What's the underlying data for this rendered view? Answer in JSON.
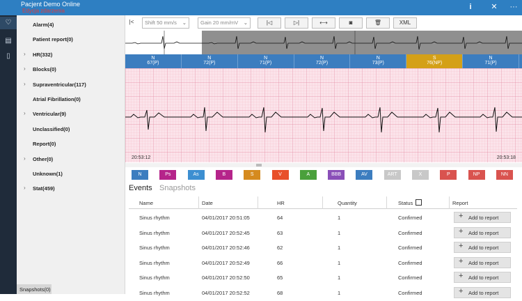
{
  "app": {
    "title": "Pacjent Demo Online",
    "subtitle": "Edycja zdarzenia"
  },
  "titlebar": {
    "info_icon": "info-icon",
    "close_icon": "close-icon",
    "more_icon": "more-icon",
    "info_glyph": "i",
    "close_glyph": "✕",
    "more_glyph": "···"
  },
  "rail": [
    {
      "name": "heart-monitor-icon",
      "glyph": "♡"
    },
    {
      "name": "clipboard-icon",
      "glyph": "▤"
    },
    {
      "name": "document-icon",
      "glyph": "▯"
    }
  ],
  "sidebar": {
    "items": [
      {
        "label": "Alarm(4)",
        "expandable": false
      },
      {
        "label": "Patient report(0)",
        "expandable": false
      },
      {
        "label": "HR(332)",
        "expandable": true
      },
      {
        "label": "Blocks(0)",
        "expandable": true
      },
      {
        "label": "Supraventricular(117)",
        "expandable": true
      },
      {
        "label": "Atrial Fibrillation(0)",
        "expandable": false
      },
      {
        "label": "Ventricular(9)",
        "expandable": true
      },
      {
        "label": "Unclassified(0)",
        "expandable": false
      },
      {
        "label": "Report(0)",
        "expandable": false
      },
      {
        "label": "Other(0)",
        "expandable": true
      },
      {
        "label": "Unknown(1)",
        "expandable": false
      },
      {
        "label": "Stat(459)",
        "expandable": true
      }
    ],
    "snapshots_tab": "Snapshots(0)"
  },
  "toolbar": {
    "collapse_glyph": "|<",
    "shift_value": "Shift 50  mm/s",
    "gain_value": "Gain 20  mm/mV",
    "prev_glyph": "|◁",
    "next_glyph": "▷|",
    "fit_glyph": "⟷",
    "camera_glyph": "◙",
    "delete_glyph": "🗑",
    "xml_label": "XML"
  },
  "beats": [
    {
      "type": "N",
      "value": "67(P)",
      "color": "#3c7dbf"
    },
    {
      "type": "N",
      "value": "72(P)",
      "color": "#3c7dbf"
    },
    {
      "type": "N",
      "value": "71(P)",
      "color": "#3c7dbf"
    },
    {
      "type": "N",
      "value": "72(P)",
      "color": "#3c7dbf"
    },
    {
      "type": "N",
      "value": "73(P)",
      "color": "#3c7dbf"
    },
    {
      "type": "S",
      "value": "76(NP)",
      "color": "#d4a017"
    },
    {
      "type": "N",
      "value": "71(P)",
      "color": "#3c7dbf"
    }
  ],
  "ecg": {
    "time_start": "20:53:12",
    "time_end": "20:53:18"
  },
  "beat_types": [
    {
      "label": "N",
      "color": "#3c7dbf"
    },
    {
      "label": "Ps",
      "color": "#b5248a"
    },
    {
      "label": "As",
      "color": "#3c8fd1"
    },
    {
      "label": "B",
      "color": "#b5248a"
    },
    {
      "label": "S",
      "color": "#d58a1e"
    },
    {
      "label": "V",
      "color": "#e8502a"
    },
    {
      "label": "A",
      "color": "#4aa03c"
    },
    {
      "label": "BBB",
      "color": "#8a4fb8"
    },
    {
      "label": "AV",
      "color": "#3c7dbf"
    },
    {
      "label": "ART",
      "color": "#c8c8c8"
    },
    {
      "label": "X",
      "color": "#c8c8c8"
    },
    {
      "label": "P",
      "color": "#d9534f"
    },
    {
      "label": "NP",
      "color": "#d9534f"
    },
    {
      "label": "NN",
      "color": "#d9534f"
    }
  ],
  "tabs": [
    {
      "label": "Events",
      "active": true
    },
    {
      "label": "Snapshots",
      "active": false
    }
  ],
  "table": {
    "headers": [
      "Name",
      "Date",
      "HR",
      "Quantity",
      "Status",
      "Report"
    ],
    "add_label": "Add to report",
    "rows": [
      {
        "name": "Sinus rhythm",
        "date": "04/01/2017 20:51:05",
        "hr": "64",
        "quantity": "1",
        "status": "Confirmed"
      },
      {
        "name": "Sinus rhythm",
        "date": "04/01/2017 20:52:45",
        "hr": "63",
        "quantity": "1",
        "status": "Confirmed"
      },
      {
        "name": "Sinus rhythm",
        "date": "04/01/2017 20:52:46",
        "hr": "62",
        "quantity": "1",
        "status": "Confirmed"
      },
      {
        "name": "Sinus rhythm",
        "date": "04/01/2017 20:52:49",
        "hr": "66",
        "quantity": "1",
        "status": "Confirmed"
      },
      {
        "name": "Sinus rhythm",
        "date": "04/01/2017 20:52:50",
        "hr": "65",
        "quantity": "1",
        "status": "Confirmed"
      },
      {
        "name": "Sinus rhythm",
        "date": "04/01/2017 20:52:52",
        "hr": "68",
        "quantity": "1",
        "status": "Confirmed"
      }
    ]
  }
}
